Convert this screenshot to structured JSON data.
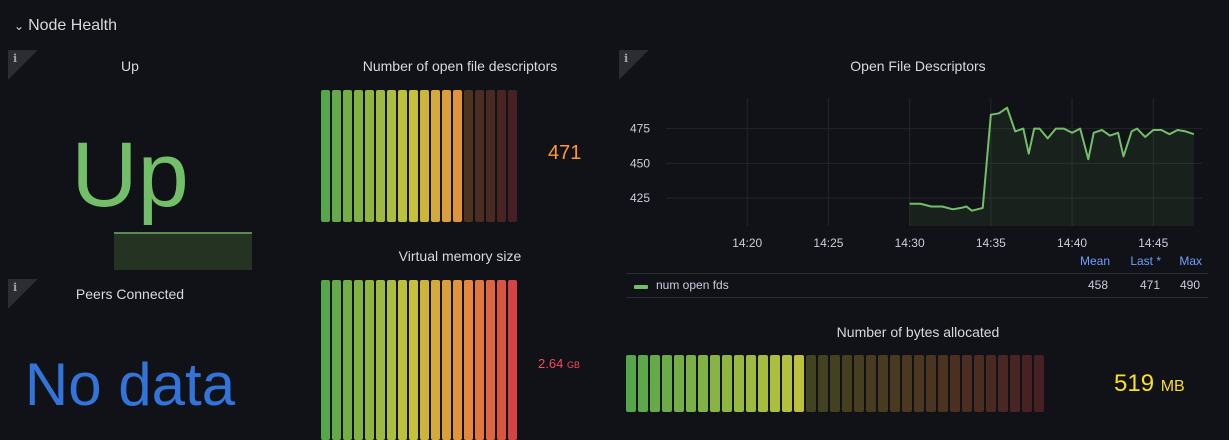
{
  "row": {
    "title": "Node Health"
  },
  "panels": {
    "up": {
      "title": "Up",
      "value": "Up",
      "color": "#73bf69",
      "info": "i"
    },
    "fds_gauge": {
      "title": "Number of open file descriptors",
      "value": "471",
      "value_color": "#ff9830",
      "fill_fraction": 0.72
    },
    "vmem": {
      "title": "Virtual memory size",
      "value": "2.64",
      "unit": "GB",
      "value_color": "#f2495c",
      "fill_fraction": 1.0
    },
    "peers": {
      "title": "Peers Connected",
      "value": "No data",
      "value_color": "#3274d9",
      "info": "i"
    },
    "fds_chart": {
      "title": "Open File Descriptors",
      "info": "i"
    },
    "bytes": {
      "title": "Number of bytes allocated",
      "value": "519",
      "unit": "MB",
      "value_color": "#fade2a",
      "fill_fraction": 0.43
    }
  },
  "legend": {
    "headers": {
      "mean": "Mean",
      "last": "Last *",
      "max": "Max"
    },
    "series": {
      "name": "num open fds",
      "mean": "458",
      "last": "471",
      "max": "490",
      "color": "#73bf69"
    }
  },
  "chart_data": {
    "type": "line",
    "title": "Open File Descriptors",
    "xlabel": "",
    "ylabel": "",
    "x_ticks": [
      "14:20",
      "14:25",
      "14:30",
      "14:35",
      "14:40",
      "14:45"
    ],
    "y_ticks": [
      425,
      450,
      475
    ],
    "xlim": [
      "14:15",
      "14:48"
    ],
    "ylim": [
      405,
      497
    ],
    "grid": true,
    "legend_position": "bottom",
    "series": [
      {
        "name": "num open fds",
        "color": "#73bf69",
        "x": [
          "14:30:00",
          "14:30:40",
          "14:31:20",
          "14:32:00",
          "14:32:40",
          "14:33:10",
          "14:33:30",
          "14:33:50",
          "14:34:30",
          "14:35:00",
          "14:35:30",
          "14:36:00",
          "14:36:30",
          "14:37:00",
          "14:37:20",
          "14:37:40",
          "14:38:00",
          "14:38:30",
          "14:39:00",
          "14:39:30",
          "14:40:00",
          "14:40:30",
          "14:41:00",
          "14:41:20",
          "14:41:50",
          "14:42:20",
          "14:42:50",
          "14:43:10",
          "14:43:40",
          "14:44:00",
          "14:44:30",
          "14:45:00",
          "14:45:30",
          "14:46:00",
          "14:46:30",
          "14:47:00",
          "14:47:30"
        ],
        "values": [
          421,
          421,
          419,
          419,
          417,
          418,
          419,
          416,
          418,
          485,
          486,
          490,
          473,
          475,
          457,
          475,
          475,
          468,
          475,
          475,
          472,
          475,
          453,
          472,
          474,
          470,
          472,
          455,
          473,
          475,
          469,
          474,
          474,
          471,
          474,
          473,
          471
        ]
      }
    ]
  }
}
